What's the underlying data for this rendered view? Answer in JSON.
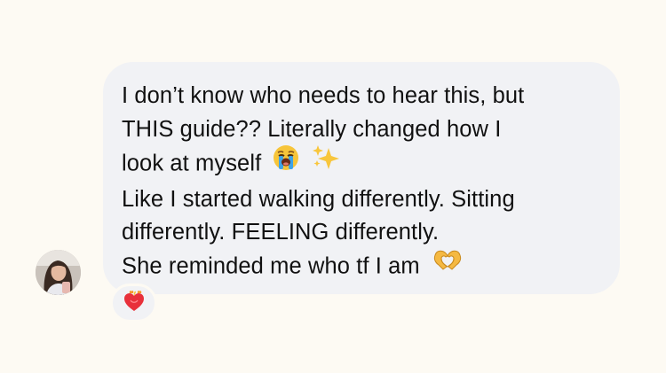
{
  "message": {
    "lines": [
      {
        "text": "I don’t know who needs to hear this, but"
      },
      {
        "text": "THIS guide?? Literally changed how I"
      },
      {
        "text": "look at myself",
        "emojis": [
          "loudly-crying-face-icon",
          "sparkles-icon"
        ]
      },
      {
        "text": "Like I started walking differently. Sitting"
      },
      {
        "text": "differently. FEELING differently."
      },
      {
        "text": "She reminded me who tf I am",
        "emojis": [
          "heart-hands-icon"
        ]
      }
    ]
  },
  "reaction": {
    "emoji": "heart-on-fire-icon"
  },
  "sender": {
    "avatar": "avatar"
  },
  "colors": {
    "background": "#fdfaf3",
    "bubble": "#f1f2f5",
    "text": "#111111"
  }
}
